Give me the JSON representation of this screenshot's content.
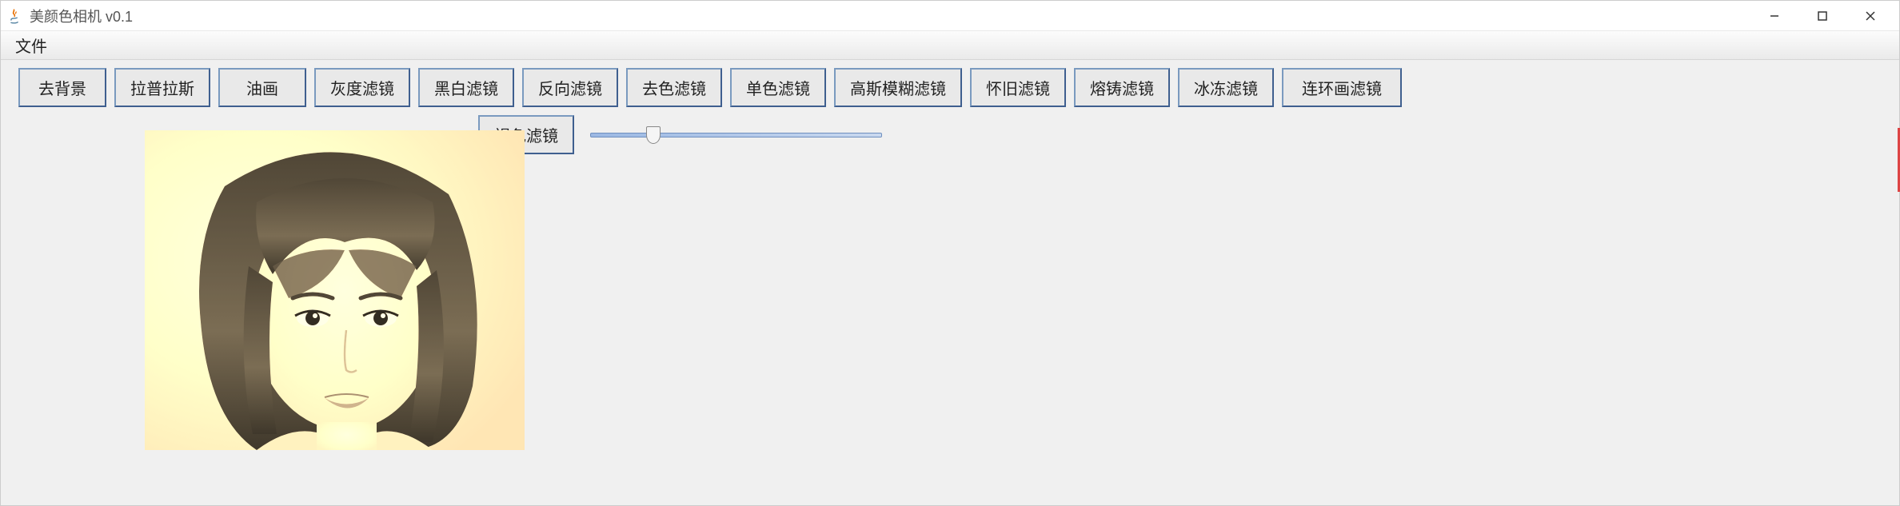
{
  "window": {
    "title": "美颜色相机 v0.1"
  },
  "menu": {
    "file": "文件"
  },
  "filters": {
    "remove_bg": "去背景",
    "laplacian": "拉普拉斯",
    "oil_paint": "油画",
    "grayscale": "灰度滤镜",
    "black_white": "黑白滤镜",
    "invert": "反向滤镜",
    "desaturate": "去色滤镜",
    "monochrome": "单色滤镜",
    "gaussian_blur": "高斯模糊滤镜",
    "nostalgic": "怀旧滤镜",
    "molten": "熔铸滤镜",
    "freeze": "冰冻滤镜",
    "comic": "连环画滤镜",
    "sepia": "褐色滤镜"
  },
  "slider": {
    "value": 20,
    "min": 0,
    "max": 100
  }
}
